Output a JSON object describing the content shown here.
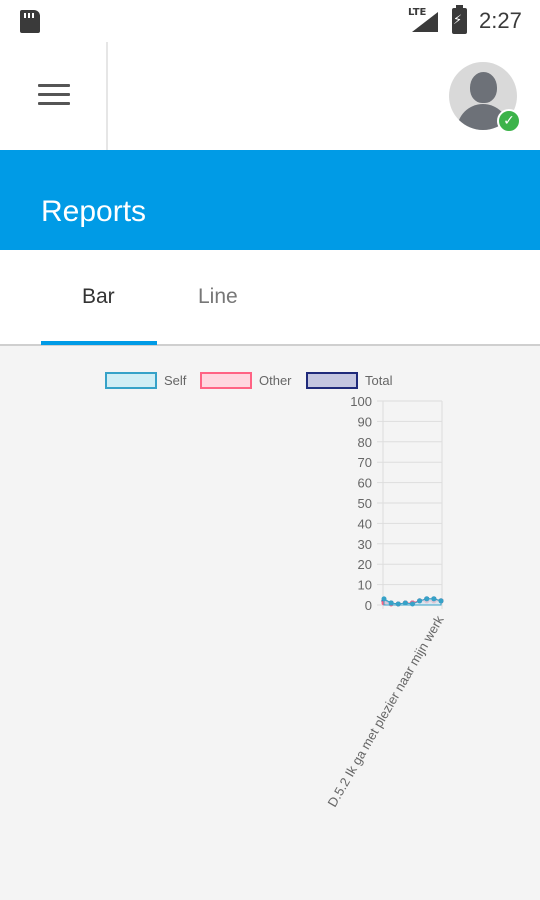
{
  "status_bar": {
    "network": "LTE",
    "time": "2:27"
  },
  "header": {
    "title": "Reports"
  },
  "tabs": [
    {
      "label": "Bar",
      "selected": true
    },
    {
      "label": "Line",
      "selected": false
    }
  ],
  "colors": {
    "accent": "#009be6",
    "online_badge": "#3cb34a"
  },
  "chart_data": {
    "type": "line",
    "categories": [
      "D.5.2 Ik ga met plezier naar mijn werk"
    ],
    "series": [
      {
        "name": "Self",
        "color": "#36a2c8",
        "fill": "#d0eef5",
        "values": [
          3,
          1,
          0.5,
          1,
          0.5,
          2,
          3,
          3,
          2
        ]
      },
      {
        "name": "Other",
        "color": "#ff6384",
        "fill": "#ffd6df",
        "values": [
          1,
          0.5,
          0.5,
          1,
          1,
          2,
          2,
          2,
          2
        ]
      },
      {
        "name": "Total",
        "color": "#1f2a7a",
        "fill": "#c4c6e0",
        "values": [
          2,
          1,
          0.5,
          1,
          1,
          2,
          3,
          3,
          2
        ]
      }
    ],
    "ylim": [
      0,
      100
    ],
    "yticks": [
      0,
      10,
      20,
      30,
      40,
      50,
      60,
      70,
      80,
      90,
      100
    ],
    "grid": true,
    "legend_position": "top"
  }
}
